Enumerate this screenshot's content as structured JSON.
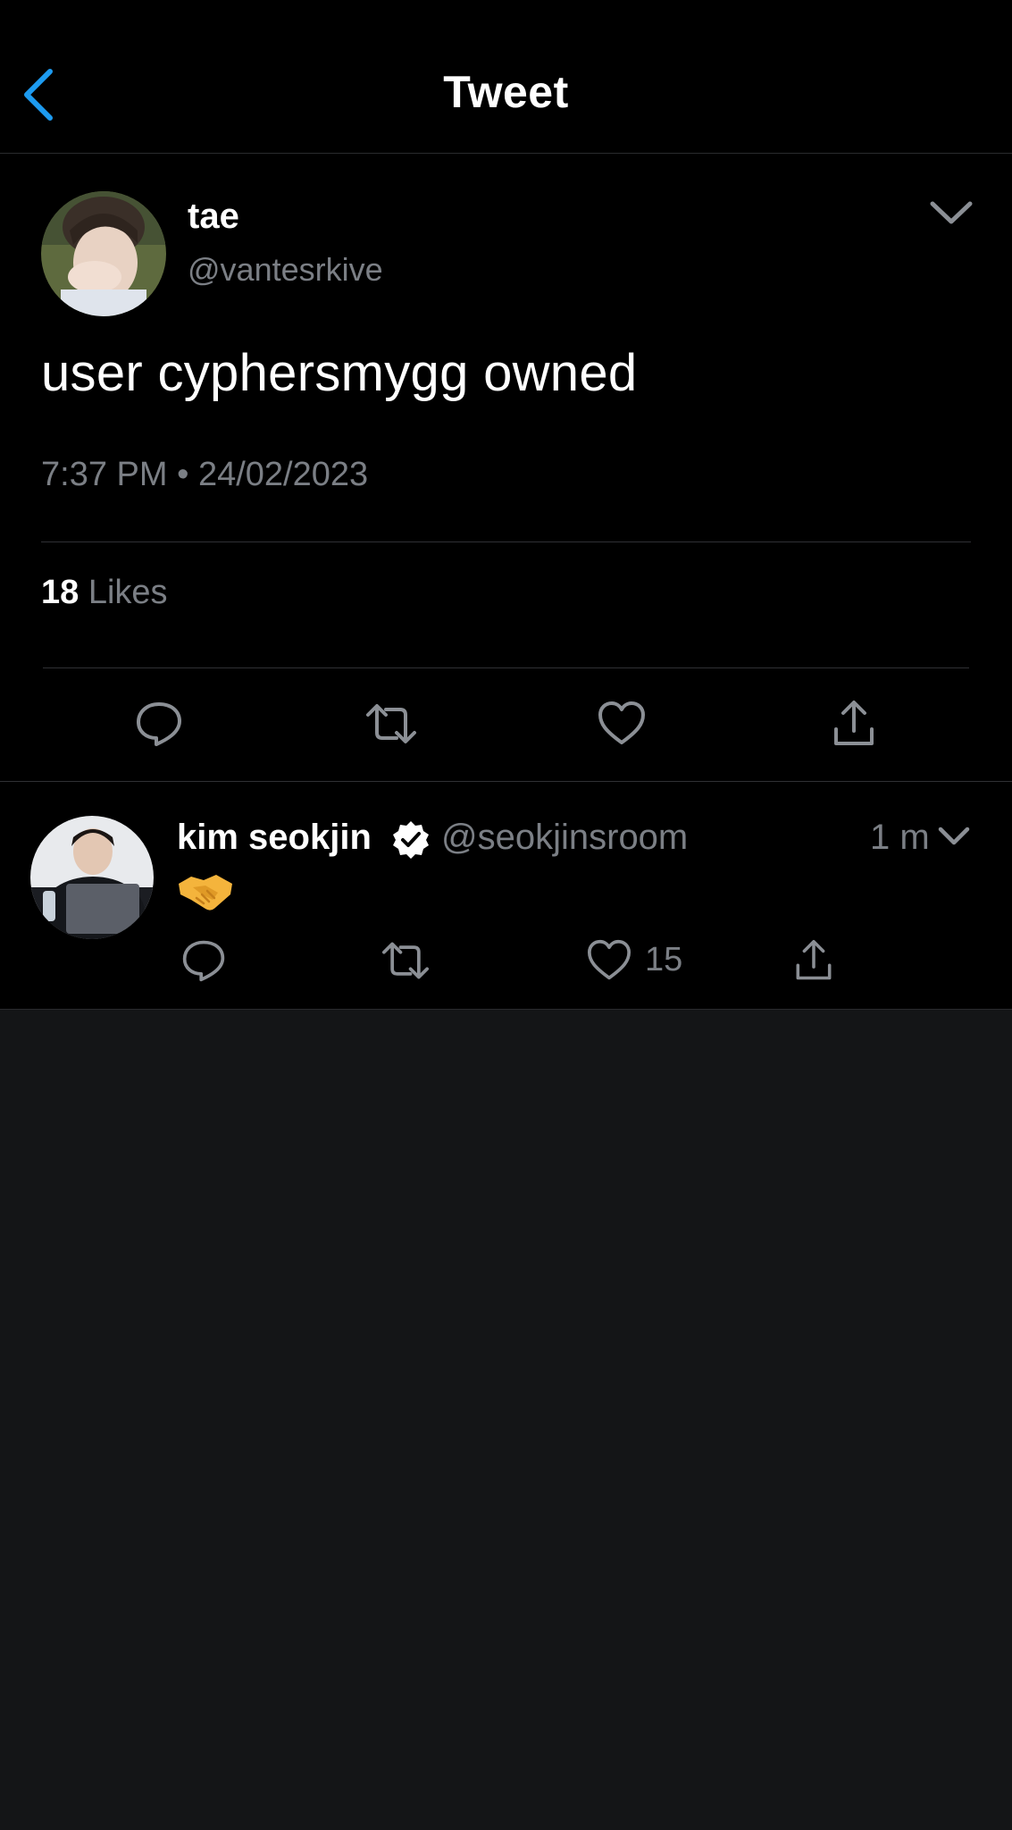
{
  "header": {
    "title": "Tweet",
    "back_icon": "chevron-left-icon",
    "accent": "#1d9bf0"
  },
  "tweet": {
    "name": "tae",
    "handle": "@vantesrkive",
    "text": "user cyphersmygg owned",
    "time": "7:37 PM",
    "separator": "•",
    "date": "24/02/2023",
    "likes_count": "18",
    "likes_label": "Likes",
    "actions": [
      "reply-icon",
      "retweet-icon",
      "like-icon",
      "share-icon"
    ]
  },
  "reply": {
    "name": "kim seokjin",
    "verified": true,
    "handle": "@seokjinsroom",
    "time": "1 m",
    "emoji": "handshake-emoji",
    "like_count": "15"
  },
  "colors": {
    "background": "#000000",
    "lower_background": "#141517",
    "secondary_text": "#7b7f85",
    "icon": "#8b8f95"
  }
}
